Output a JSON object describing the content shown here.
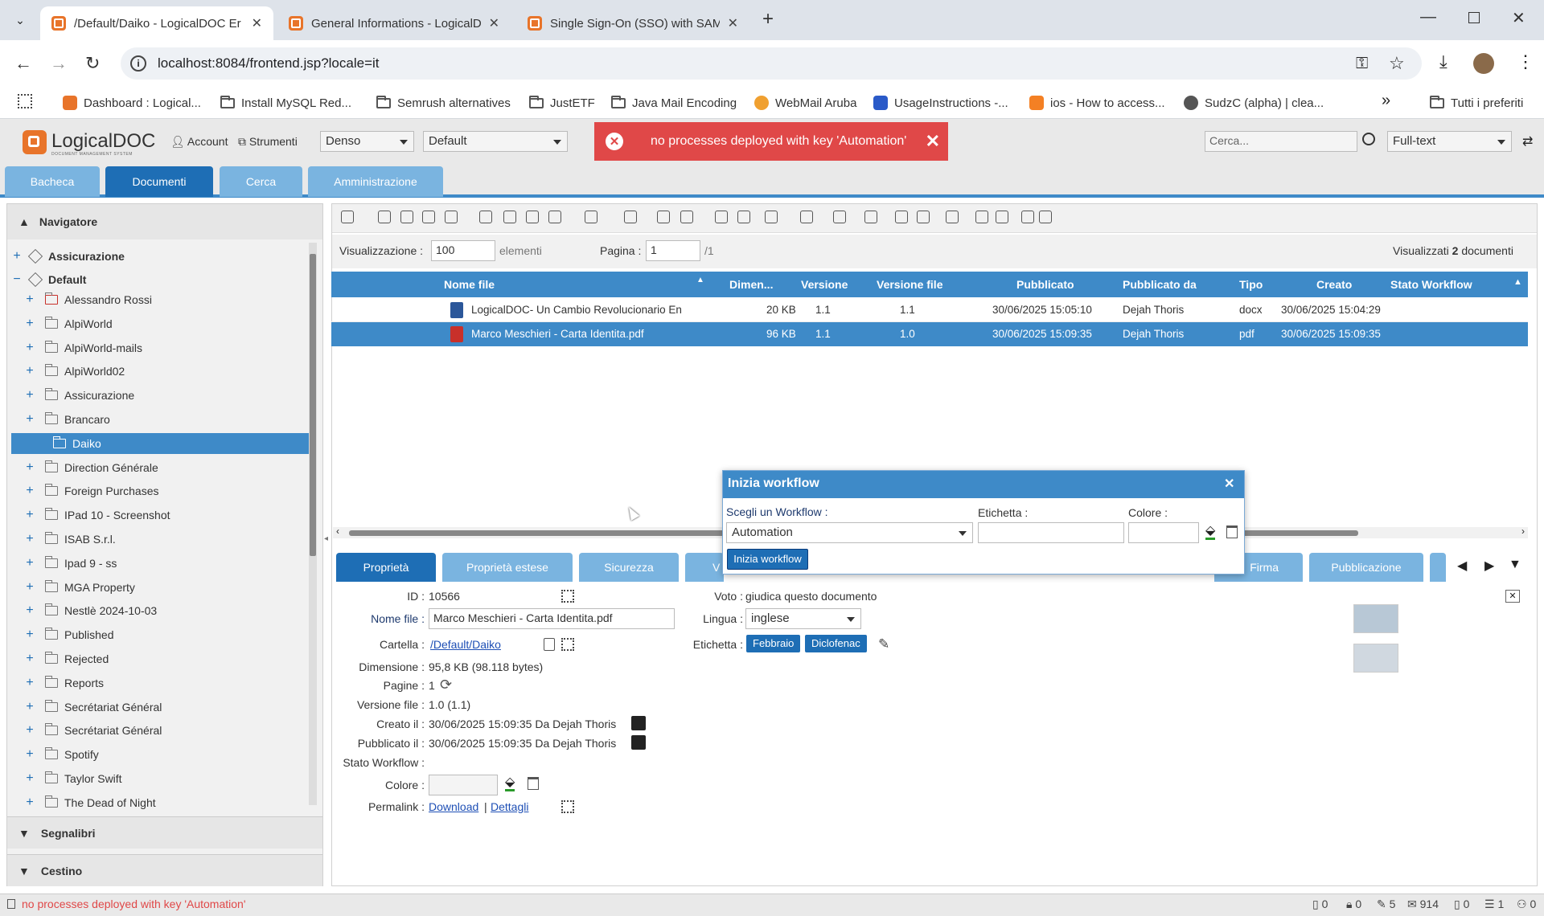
{
  "browser": {
    "tabs": [
      {
        "label": "/Default/Daiko - LogicalDOC Er",
        "active": true
      },
      {
        "label": "General Informations - LogicalD",
        "active": false
      },
      {
        "label": "Single Sign-On (SSO) with SAM",
        "active": false
      }
    ],
    "url": "localhost:8084/frontend.jsp?locale=it",
    "bookmarks": [
      "Dashboard : Logical...",
      "Install MySQL Red...",
      "Semrush alternatives",
      "JustETF",
      "Java Mail Encoding",
      "WebMail Aruba",
      "UsageInstructions -...",
      "ios - How to access...",
      "SudzC (alpha) | clea..."
    ],
    "bookmarks_all": "Tutti i preferiti"
  },
  "app": {
    "logo": "LogicalDOC",
    "logo_tagline": "DOCUMENT MANAGEMENT SYSTEM",
    "account_label": "Account",
    "tools_label": "Strumenti",
    "density_value": "Denso",
    "theme_value": "Default",
    "search_placeholder": "Cerca...",
    "search_type": "Full-text",
    "toast_message": "no processes deployed with key 'Automation'",
    "main_tabs": [
      "Bacheca",
      "Documenti",
      "Cerca",
      "Amministrazione"
    ],
    "active_main_tab": "Documenti"
  },
  "navigator": {
    "title": "Navigatore",
    "roots": [
      "Assicurazione",
      "Default"
    ],
    "folders": [
      "Alessandro Rossi",
      "AlpiWorld",
      "AlpiWorld-mails",
      "AlpiWorld02",
      "Assicurazione",
      "Brancaro",
      "Daiko",
      "Direction Générale",
      "Foreign Purchases",
      "IPad 10 - Screenshot",
      "ISAB S.r.l.",
      "Ipad 9 - ss",
      "MGA Property",
      "Nestlè 2024-10-03",
      "Published",
      "Rejected",
      "Reports",
      "Secrétariat Général",
      "Secrétariat Général",
      "Spotify",
      "Taylor Swift",
      "The Dead of Night"
    ],
    "selected_folder": "Daiko",
    "bookmarks_section": "Segnalibri",
    "trash_section": "Cestino"
  },
  "documents": {
    "display_label": "Visualizzazione :",
    "display_value": "100",
    "elements_label": "elementi",
    "page_label": "Pagina :",
    "page_value": "1",
    "page_total": "/1",
    "shown_prefix": "Visualizzati",
    "shown_count": "2",
    "shown_suffix": "documenti",
    "columns": [
      "Nome file",
      "Dimen...",
      "Versione",
      "Versione file",
      "Pubblicato",
      "Pubblicato da",
      "Tipo",
      "Creato",
      "Stato Workflow"
    ],
    "rows": [
      {
        "name": "LogicalDOC- Un Cambio Revolucionario En La Gestió",
        "size": "20 KB",
        "version": "1.1",
        "file_version": "1.1",
        "published": "30/06/2025 15:05:10",
        "published_by": "Dejah Thoris",
        "type": "docx",
        "created": "30/06/2025 15:04:29",
        "workflow": ""
      },
      {
        "name": "Marco Meschieri - Carta Identita.pdf",
        "size": "96 KB",
        "version": "1.1",
        "file_version": "1.0",
        "published": "30/06/2025 15:09:35",
        "published_by": "Dejah Thoris",
        "type": "pdf",
        "created": "30/06/2025 15:09:35",
        "workflow": ""
      }
    ]
  },
  "detail_tabs": [
    "Proprietà",
    "Proprietà estese",
    "Sicurezza",
    "V",
    "Firma",
    "Pubblicazione"
  ],
  "properties": {
    "id_label": "ID :",
    "id_value": "10566",
    "filename_label": "Nome file :",
    "filename_value": "Marco Meschieri - Carta Identita.pdf",
    "folder_label": "Cartella :",
    "folder_value": "/Default/Daiko",
    "size_label": "Dimensione :",
    "size_value": "95,8 KB (98.118 bytes)",
    "pages_label": "Pagine :",
    "pages_value": "1",
    "fileversion_label": "Versione file :",
    "fileversion_value": "1.0 (1.1)",
    "created_label": "Creato il :",
    "created_value": "30/06/2025 15:09:35 Da Dejah Thoris",
    "published_label": "Pubblicato il :",
    "published_value": "30/06/2025 15:09:35 Da Dejah Thoris",
    "workflow_label": "Stato Workflow :",
    "color_label": "Colore :",
    "permalink_label": "Permalink :",
    "download_label": "Download",
    "separator": "|",
    "details_label": "Dettagli",
    "vote_label": "Voto :",
    "vote_value": "giudica questo documento",
    "language_label": "Lingua :",
    "language_value": "inglese",
    "tags_label": "Etichetta :",
    "tags": [
      "Febbraio",
      "Diclofenac"
    ]
  },
  "dialog": {
    "title": "Inizia workflow",
    "workflow_label": "Scegli un Workflow :",
    "workflow_value": "Automation",
    "tag_label": "Etichetta :",
    "color_label": "Colore :",
    "start_button": "Inizia workflow"
  },
  "statusbar": {
    "message": "no processes deployed with key 'Automation'",
    "counters": [
      "0",
      "0",
      "5",
      "914",
      "0",
      "1",
      "0"
    ]
  },
  "colors": {
    "accent": "#3e8ac8",
    "accent_dark": "#1e6eb5",
    "error": "#e04848",
    "brand_orange": "#e8742a"
  }
}
